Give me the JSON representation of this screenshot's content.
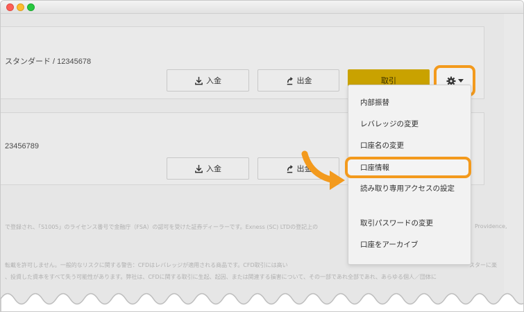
{
  "window": {
    "controls": [
      "close",
      "minimize",
      "maximize"
    ]
  },
  "accounts": [
    {
      "label": "スタンダード / 12345678",
      "deposit_label": "入金",
      "withdraw_label": "出金",
      "trade_label": "取引"
    },
    {
      "label": "23456789",
      "deposit_label": "入金",
      "withdraw_label": "出金"
    }
  ],
  "settings_menu": {
    "items": [
      "内部振替",
      "レバレッジの変更",
      "口座名の変更",
      "口座情報",
      "読み取り専用アクセスの設定",
      "取引パスワードの変更",
      "口座をアーカイブ"
    ],
    "highlighted_index": 3
  },
  "footer": {
    "line1": "で登録され、「S1005」のライセンス番号で金融庁（FSA）の認可を受けた証券ディーラーです。Exness (SC) LTDの登記上の",
    "line1_tail": "Providence,",
    "line2": "転載を許可しません。一般的なリスクに関する警告：CFDはレバレッジが適用される商品です。CFD取引には高い",
    "line2_tail": "スターに楽",
    "line3": "、投資した資本をすべて失う可能性があります。弊社は、CFDに関する取引に生起、起因、または関連する損害について、その一部であれ全部であれ、あらゆる個人／団体に"
  },
  "colors": {
    "accent": "#f39a1d",
    "trade_button": "#c9a200"
  },
  "icons": [
    "download-icon",
    "upload-icon",
    "gear-icon",
    "caret-down-icon",
    "pointer-arrow"
  ]
}
